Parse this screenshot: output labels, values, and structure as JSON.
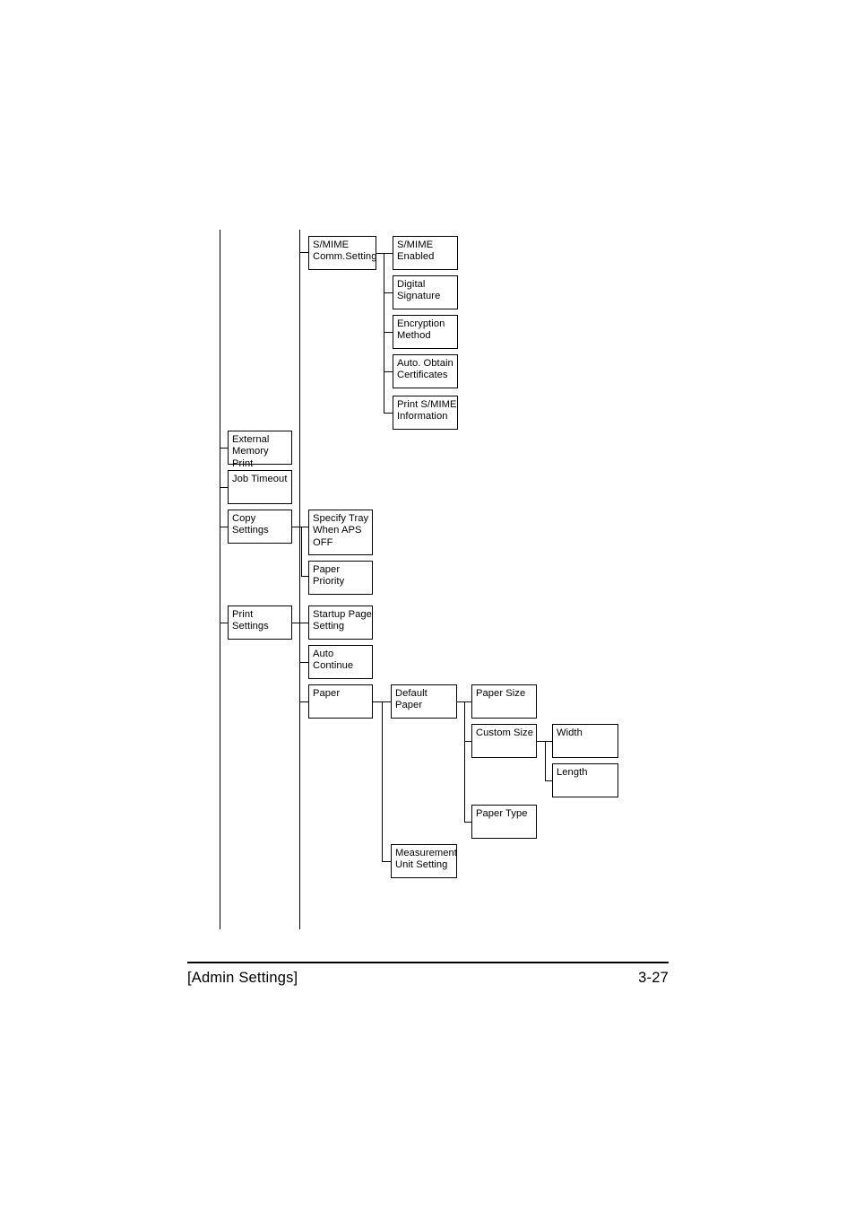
{
  "footer": {
    "section_label": "[Admin Settings]",
    "page_number": "3-27"
  },
  "diagram": {
    "type": "menu-tree",
    "columns": 5,
    "nodes": {
      "smime_comm_setting": "S/MIME\nComm.Setting",
      "smime_enabled": "S/MIME\nEnabled",
      "digital_signature": "Digital\nSignature",
      "encryption_method": "Encryption\nMethod",
      "auto_obtain_certificates": "Auto. Obtain\nCertificates",
      "print_smime_information": "Print S/MIME\nInformation",
      "external_memory_print": "External\nMemory Print",
      "job_timeout": "Job Timeout",
      "copy_settings": "Copy Settings",
      "specify_tray_when_aps_off": "Specify Tray\nWhen APS\nOFF",
      "paper_priority": "Paper Priority",
      "print_settings": "Print Settings",
      "startup_page_setting": "Startup Page\nSetting",
      "auto_continue": "Auto\nContinue",
      "paper": "Paper",
      "default_paper": "Default\nPaper",
      "paper_size": "Paper Size",
      "custom_size": "Custom Size",
      "width": "Width",
      "length": "Length",
      "paper_type": "Paper Type",
      "measurement_unit_setting": "Measurement\nUnit Setting"
    }
  }
}
